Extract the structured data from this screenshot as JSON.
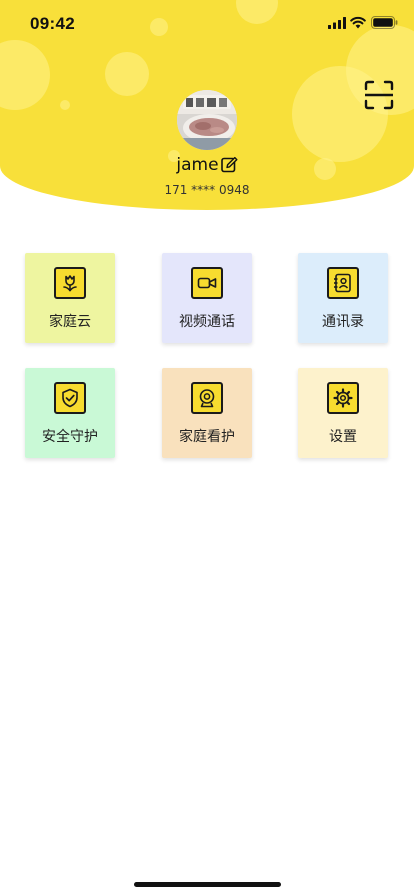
{
  "status_bar": {
    "time": "09:42",
    "signal_icon": "cellular-signal-icon",
    "wifi_icon": "wifi-icon",
    "battery_icon": "battery-icon"
  },
  "header": {
    "background_color": "#f8e03a",
    "scan_icon": "scan-icon"
  },
  "profile": {
    "avatar_icon": "avatar-photo",
    "username": "jame",
    "edit_icon": "edit-icon",
    "phone": "171 **** 0948"
  },
  "tiles": [
    {
      "label": "家庭云",
      "icon": "tulip-icon",
      "bg_color": "#eef5a0"
    },
    {
      "label": "视频通话",
      "icon": "video-camera-icon",
      "bg_color": "#e4e6fb"
    },
    {
      "label": "通讯录",
      "icon": "contacts-icon",
      "bg_color": "#dcedfb"
    },
    {
      "label": "安全守护",
      "icon": "shield-check-icon",
      "bg_color": "#c9f9d6"
    },
    {
      "label": "家庭看护",
      "icon": "webcam-icon",
      "bg_color": "#f9e1bd"
    },
    {
      "label": "设置",
      "icon": "gear-icon",
      "bg_color": "#fdf2cc"
    }
  ]
}
